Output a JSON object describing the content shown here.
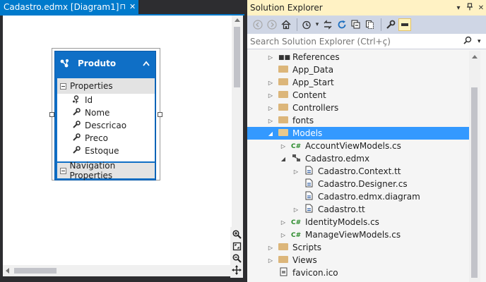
{
  "designer": {
    "tab_title": "Cadastro.edmx [Diagram1]",
    "pin_glyph": "⊓",
    "close_glyph": "✕",
    "entity": {
      "name": "Produto",
      "properties_label": "Properties",
      "properties": [
        "Id",
        "Nome",
        "Descricao",
        "Preco",
        "Estoque"
      ],
      "navigation_label": "Navigation Properties"
    }
  },
  "solution_explorer": {
    "title": "Solution Explorer",
    "search_placeholder": "Search Solution Explorer (Ctrl+ç)",
    "tree": [
      {
        "label": "References",
        "level": 1,
        "expander": "collapsed",
        "icon": "references-icon"
      },
      {
        "label": "App_Data",
        "level": 1,
        "expander": "none",
        "icon": "folder-icon"
      },
      {
        "label": "App_Start",
        "level": 1,
        "expander": "collapsed",
        "icon": "folder-icon"
      },
      {
        "label": "Content",
        "level": 1,
        "expander": "collapsed",
        "icon": "folder-icon"
      },
      {
        "label": "Controllers",
        "level": 1,
        "expander": "collapsed",
        "icon": "folder-icon"
      },
      {
        "label": "fonts",
        "level": 1,
        "expander": "collapsed",
        "icon": "folder-icon"
      },
      {
        "label": "Models",
        "level": 1,
        "expander": "expanded",
        "icon": "folder-open-icon",
        "selected": true
      },
      {
        "label": "AccountViewModels.cs",
        "level": 2,
        "expander": "collapsed",
        "icon": "csharp-file-icon"
      },
      {
        "label": "Cadastro.edmx",
        "level": 2,
        "expander": "expanded",
        "icon": "edmx-file-icon"
      },
      {
        "label": "Cadastro.Context.tt",
        "level": 3,
        "expander": "collapsed",
        "icon": "template-file-icon"
      },
      {
        "label": "Cadastro.Designer.cs",
        "level": 3,
        "expander": "none",
        "icon": "template-file-icon"
      },
      {
        "label": "Cadastro.edmx.diagram",
        "level": 3,
        "expander": "none",
        "icon": "template-file-icon"
      },
      {
        "label": "Cadastro.tt",
        "level": 3,
        "expander": "collapsed",
        "icon": "template-file-icon"
      },
      {
        "label": "IdentityModels.cs",
        "level": 2,
        "expander": "collapsed",
        "icon": "csharp-file-icon"
      },
      {
        "label": "ManageViewModels.cs",
        "level": 2,
        "expander": "collapsed",
        "icon": "csharp-file-icon"
      },
      {
        "label": "Scripts",
        "level": 1,
        "expander": "collapsed",
        "icon": "folder-icon"
      },
      {
        "label": "Views",
        "level": 1,
        "expander": "collapsed",
        "icon": "folder-icon"
      },
      {
        "label": "favicon.ico",
        "level": 1,
        "expander": "none",
        "icon": "image-file-icon"
      }
    ]
  },
  "colors": {
    "accent": "#007acc",
    "entity_blue": "#0f6fc6",
    "selection": "#3399ff",
    "toolbar": "#cfd6e5",
    "title_highlight": "#fff2c4"
  }
}
